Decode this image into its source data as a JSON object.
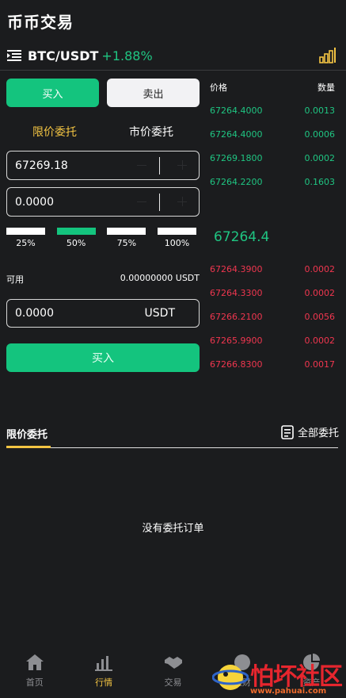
{
  "header": {
    "title": "币币交易"
  },
  "pair": {
    "name": "BTC/USDT",
    "change": "+1.88%"
  },
  "side": {
    "buy_label": "买入",
    "sell_label": "卖出"
  },
  "order_types": {
    "limit": "限价委托",
    "market": "市价委托"
  },
  "form": {
    "price_value": "67269.18",
    "amount_value": "0.0000",
    "percent_options": [
      "25%",
      "50%",
      "75%",
      "100%"
    ],
    "percent_selected": "50%",
    "available_label": "可用",
    "available_value": "0.00000000 USDT",
    "total_value": "0.0000",
    "total_unit": "USDT",
    "submit_label": "买入"
  },
  "order_book": {
    "price_header": "价格",
    "qty_header": "数量",
    "bids": [
      {
        "price": "67264.4000",
        "qty": "0.0013"
      },
      {
        "price": "67264.4000",
        "qty": "0.0006"
      },
      {
        "price": "67269.1800",
        "qty": "0.0002"
      },
      {
        "price": "67264.2200",
        "qty": "0.1603"
      }
    ],
    "last_price": "67264.4",
    "asks": [
      {
        "price": "67264.3900",
        "qty": "0.0002"
      },
      {
        "price": "67264.3300",
        "qty": "0.0002"
      },
      {
        "price": "67266.2100",
        "qty": "0.0056"
      },
      {
        "price": "67265.9900",
        "qty": "0.0002"
      },
      {
        "price": "67266.8300",
        "qty": "0.0017"
      }
    ]
  },
  "orders": {
    "title": "限价委托",
    "all_label": "全部委托",
    "empty_text": "没有委托订单"
  },
  "tabbar": [
    {
      "label": "首页",
      "icon": "home-icon"
    },
    {
      "label": "行情",
      "icon": "market-chart-icon"
    },
    {
      "label": "交易",
      "icon": "handshake-icon"
    },
    {
      "label": "理财",
      "icon": "finance-icon"
    },
    {
      "label": "资产",
      "icon": "assets-pie-icon"
    }
  ],
  "watermark": {
    "text": "怕坏社区",
    "url": "www.pahuai.com"
  },
  "colors": {
    "green": "#14c47e",
    "red": "#f0364f",
    "gold": "#f3c443",
    "background": "#1b1c1e"
  }
}
